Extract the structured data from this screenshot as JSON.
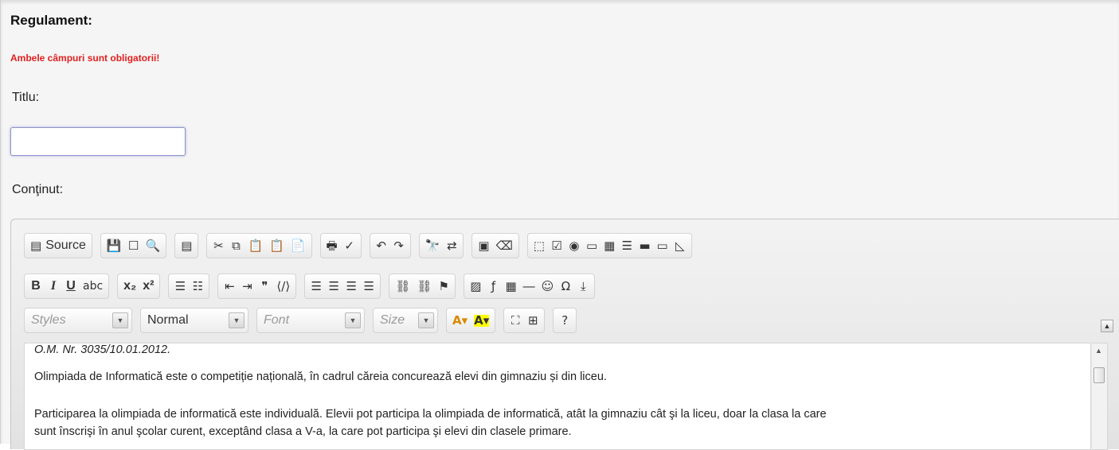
{
  "form": {
    "heading": "Regulament:",
    "required_note": "Ambele câmpuri sunt obligatorii!",
    "title_label": "Titlu:",
    "title_value": "",
    "content_label": "Conţinut:"
  },
  "colors": {
    "required_note": "#e02020",
    "input_focus_border": "#8e93c9"
  },
  "toolbar": {
    "source_label": "Source",
    "row1": [
      {
        "name": "save-icon",
        "glyph": "💾"
      },
      {
        "name": "new-page-icon",
        "glyph": "☐"
      },
      {
        "name": "preview-icon",
        "glyph": "🔍"
      },
      {
        "name": "templates-icon",
        "glyph": "▤"
      },
      {
        "name": "cut-icon",
        "glyph": "✂"
      },
      {
        "name": "copy-icon",
        "glyph": "⧉"
      },
      {
        "name": "paste-icon",
        "glyph": "📋"
      },
      {
        "name": "paste-text-icon",
        "glyph": "📋"
      },
      {
        "name": "paste-word-icon",
        "glyph": "📄"
      },
      {
        "name": "print-icon",
        "glyph": "🖶"
      },
      {
        "name": "spellcheck-icon",
        "glyph": "✓"
      },
      {
        "name": "undo-icon",
        "glyph": "↶"
      },
      {
        "name": "redo-icon",
        "glyph": "↷"
      },
      {
        "name": "find-icon",
        "glyph": "🔭"
      },
      {
        "name": "replace-icon",
        "glyph": "⇄"
      },
      {
        "name": "select-all-icon",
        "glyph": "▣"
      },
      {
        "name": "remove-format-icon",
        "glyph": "⌫"
      },
      {
        "name": "form-icon",
        "glyph": "⬚"
      },
      {
        "name": "checkbox-icon",
        "glyph": "☑"
      },
      {
        "name": "radio-icon",
        "glyph": "◉"
      },
      {
        "name": "text-field-icon",
        "glyph": "▭"
      },
      {
        "name": "textarea-icon",
        "glyph": "▦"
      },
      {
        "name": "select-icon",
        "glyph": "☰"
      },
      {
        "name": "button-icon",
        "glyph": "▬"
      },
      {
        "name": "image-button-icon",
        "glyph": "▭"
      },
      {
        "name": "hidden-field-icon",
        "glyph": "◺"
      }
    ],
    "row2": [
      {
        "name": "bold-icon",
        "text": "B",
        "cls": "b"
      },
      {
        "name": "italic-icon",
        "text": "I",
        "cls": "i"
      },
      {
        "name": "underline-icon",
        "text": "U",
        "cls": "u"
      },
      {
        "name": "strikethrough-icon",
        "text": "abc",
        "cls": ""
      },
      {
        "name": "subscript-icon",
        "text": "x₂",
        "cls": "b"
      },
      {
        "name": "superscript-icon",
        "text": "x²",
        "cls": "b"
      },
      {
        "name": "numbered-list-icon",
        "glyph": "☰"
      },
      {
        "name": "bulleted-list-icon",
        "glyph": "☷"
      },
      {
        "name": "outdent-icon",
        "glyph": "⇤"
      },
      {
        "name": "indent-icon",
        "glyph": "⇥"
      },
      {
        "name": "blockquote-icon",
        "glyph": "❞"
      },
      {
        "name": "create-div-icon",
        "glyph": "⟨/⟩"
      },
      {
        "name": "align-left-icon",
        "glyph": "☰"
      },
      {
        "name": "align-center-icon",
        "glyph": "☰"
      },
      {
        "name": "align-right-icon",
        "glyph": "☰"
      },
      {
        "name": "justify-icon",
        "glyph": "☰"
      },
      {
        "name": "link-icon",
        "glyph": "⛓"
      },
      {
        "name": "unlink-icon",
        "glyph": "⛓"
      },
      {
        "name": "anchor-icon",
        "glyph": "⚑"
      },
      {
        "name": "image-icon",
        "glyph": "▨"
      },
      {
        "name": "flash-icon",
        "glyph": "ƒ"
      },
      {
        "name": "table-icon",
        "glyph": "▦"
      },
      {
        "name": "horizontal-rule-icon",
        "glyph": "―"
      },
      {
        "name": "smiley-icon",
        "glyph": "☺"
      },
      {
        "name": "special-char-icon",
        "glyph": "Ω"
      },
      {
        "name": "page-break-icon",
        "glyph": "⤓"
      }
    ],
    "row3_combos": {
      "styles": "Styles",
      "format": "Normal",
      "font": "Font",
      "size": "Size"
    },
    "row3_buttons": [
      {
        "name": "text-color-icon",
        "glyph": "A▾"
      },
      {
        "name": "background-color-icon",
        "glyph": "A▾"
      },
      {
        "name": "maximize-icon",
        "glyph": "⛶"
      },
      {
        "name": "show-blocks-icon",
        "glyph": "⊞"
      },
      {
        "name": "help-icon",
        "glyph": "?"
      }
    ]
  },
  "editor_content": {
    "line1": "O.M. Nr. 3035/10.01.2012.",
    "para1": "Olimpiada de Informatică este o competiție națională, în cadrul căreia concurează elevi din gimnaziu și din liceu.",
    "para2_line1": "Participarea la olimpiada de informatică este individuală. Elevii pot participa la olimpiada de informatică, atât la gimnaziu cât şi la liceu, doar la clasa la care",
    "para2_line2": "sunt înscrişi în anul şcolar curent, exceptând clasa a V-a, la care pot participa şi elevi din clasele primare."
  }
}
